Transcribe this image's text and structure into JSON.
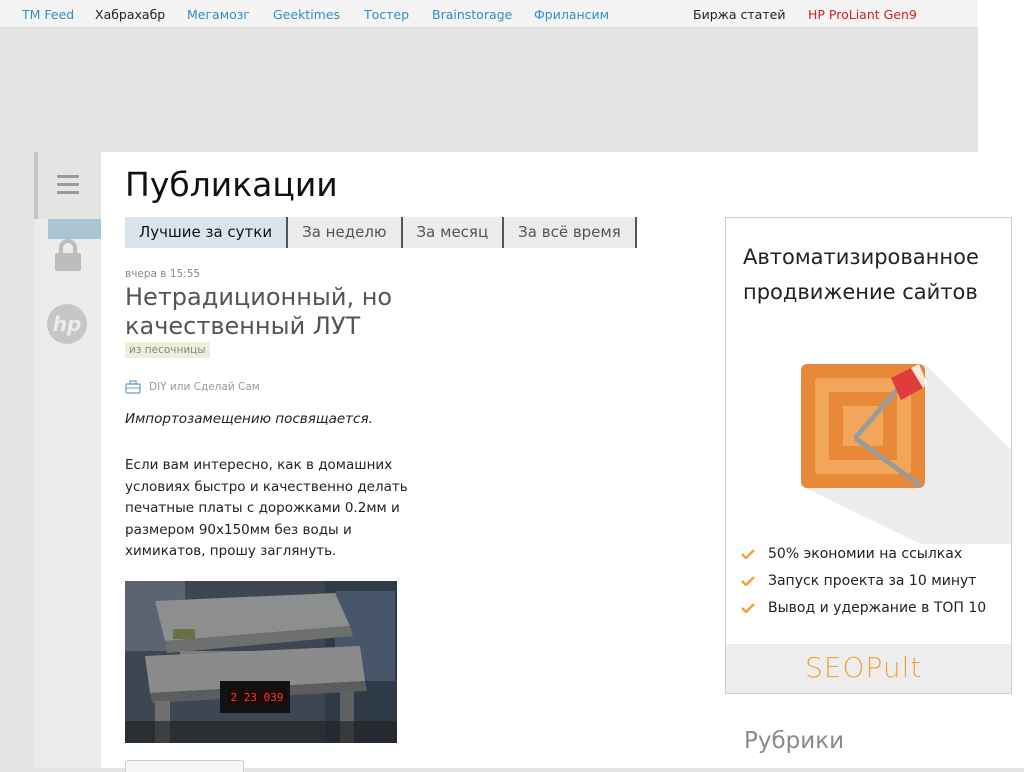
{
  "nav": {
    "links": [
      {
        "label": "TM Feed",
        "style": "blue"
      },
      {
        "label": "Хабрахабр",
        "style": "dark"
      },
      {
        "label": "Мегамозг",
        "style": "blue"
      },
      {
        "label": "Geektimes",
        "style": "blue"
      },
      {
        "label": "Тостер",
        "style": "blue"
      },
      {
        "label": "Brainstorage",
        "style": "blue"
      },
      {
        "label": "Фрилансим",
        "style": "blue"
      }
    ],
    "right_links": [
      {
        "label": "Биржа статей",
        "style": "dark"
      },
      {
        "label": "HP ProLiant Gen9",
        "style": "red"
      }
    ]
  },
  "sidebar": {
    "icons": [
      "menu-icon",
      "lock-icon",
      "hp-logo-icon"
    ]
  },
  "page": {
    "title": "Публикации"
  },
  "tabs": [
    {
      "label": "Лучшие за сутки",
      "active": true
    },
    {
      "label": "За неделю",
      "active": false
    },
    {
      "label": "За месяц",
      "active": false
    },
    {
      "label": "За всё время",
      "active": false
    }
  ],
  "post": {
    "time": "вчера в 15:55",
    "title": "Нетрадиционный, но качественный ЛУТ",
    "badge": "из песочницы",
    "hub": "DIY или Сделай Сам",
    "lead": "Импортозамещению посвящается.",
    "body": "Если вам интересно, как в домашних условиях быстро и качественно делать печатные платы с дорожками 0.2мм и размером 90х150мм без воды и химикатов, прошу заглянуть.",
    "photo_display": "2 23 039"
  },
  "ad": {
    "headline": "Автоматизированное продвижение сайтов",
    "features": [
      "50% экономии на ссылках",
      "Запуск проекта за 10 минут",
      "Вывод и удержание в ТОП 10"
    ],
    "brand": "SEOPult",
    "accent_color": "#f2a23b"
  },
  "rubrics": {
    "title": "Рубрики"
  }
}
